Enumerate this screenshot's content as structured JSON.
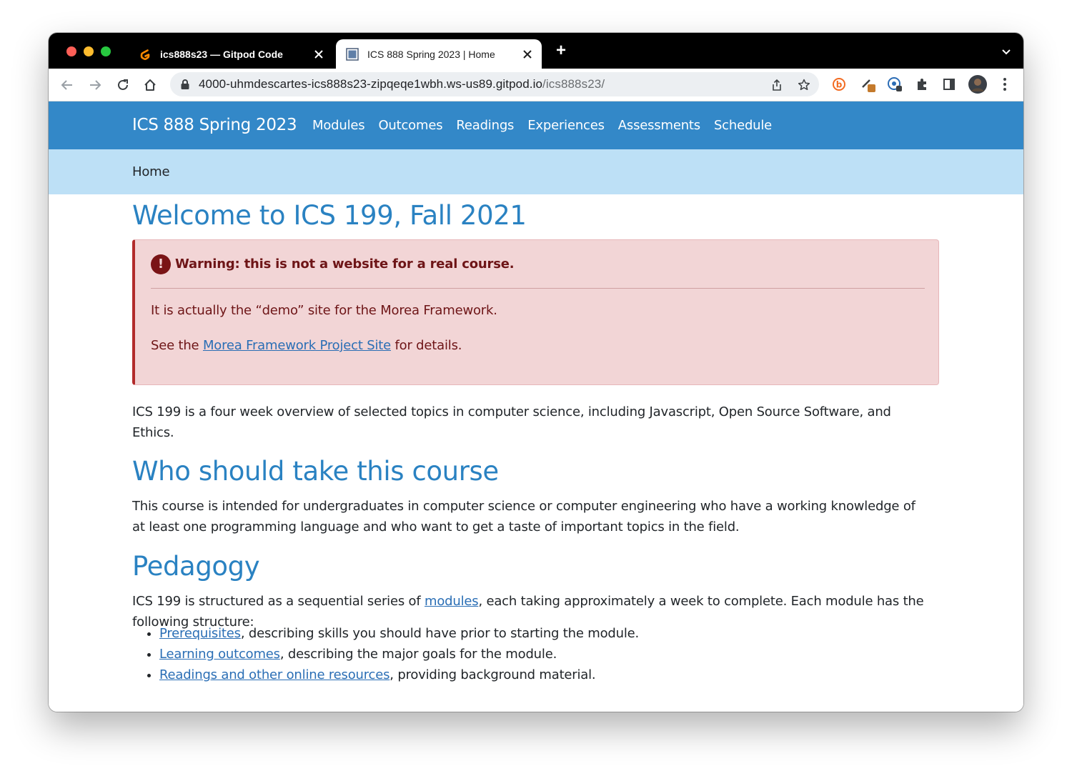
{
  "browser": {
    "tabs": [
      {
        "title": "ics888s23 — Gitpod Code",
        "favicon": "gitpod-icon",
        "active": false
      },
      {
        "title": "ICS 888 Spring 2023 | Home",
        "favicon": "page-icon",
        "active": true
      }
    ],
    "url_host": "4000-uhmdescartes-ics888s23-zipqeqe1wbh.ws-us89.gitpod.io",
    "url_path": "/ics888s23/"
  },
  "site": {
    "brand": "ICS 888 Spring 2023",
    "nav": [
      "Modules",
      "Outcomes",
      "Readings",
      "Experiences",
      "Assessments",
      "Schedule"
    ],
    "breadcrumb": "Home"
  },
  "content": {
    "title": "Welcome to ICS 199, Fall 2021",
    "alert": {
      "icon": "!",
      "heading": "Warning: this is not a website for a real course.",
      "line1": "It is actually the “demo” site for the Morea Framework.",
      "line2_before": "See the ",
      "line2_link": "Morea Framework Project Site",
      "line2_after": " for details."
    },
    "intro_line1": "ICS 199 is a four week overview of selected topics in computer science, including Javascript, Open Source Software, and",
    "intro_line2": "Ethics.",
    "who_heading": "Who should take this course",
    "who_line1": "This course is intended for undergraduates in computer science or computer engineering who have a working knowledge of",
    "who_line2": "at least one programming language and who want to get a taste of important topics in the field.",
    "pedagogy_heading": "Pedagogy",
    "pedagogy_before": "ICS 199 is structured as a sequential series of ",
    "pedagogy_link": "modules",
    "pedagogy_after": ", each taking approximately a week to complete. Each module has the",
    "pedagogy_line2": "following structure:",
    "structure": [
      {
        "link": "Prerequisites",
        "text": ", describing skills you should have prior to starting the module."
      },
      {
        "link": "Learning outcomes",
        "text": ", describing the major goals for the module."
      },
      {
        "link": "Readings and other online resources",
        "text": ", providing background material."
      }
    ]
  },
  "colors": {
    "navbar": "#3388c8",
    "breadcrumb_bar": "#bde0f6",
    "heading": "#2a82c2",
    "alert_bg": "#f2d5d6",
    "alert_text": "#6e1517",
    "link": "#2a6eb5"
  }
}
